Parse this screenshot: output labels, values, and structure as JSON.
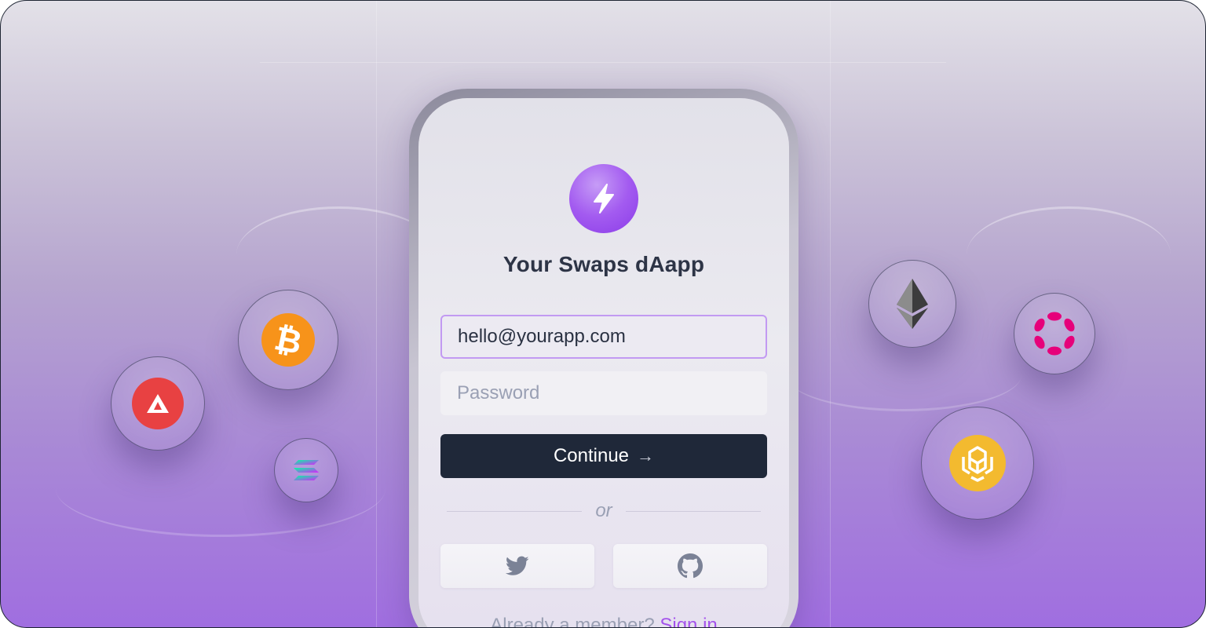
{
  "app": {
    "title": "Your Swaps dAapp"
  },
  "form": {
    "email_value": "hello@yourapp.com",
    "password_placeholder": "Password",
    "continue_label": "Continue",
    "continue_arrow": "→",
    "divider_text": "or",
    "member_text": "Already a member?",
    "signin_label": "Sign in"
  },
  "social_buttons": [
    {
      "icon": "twitter-icon"
    },
    {
      "icon": "github-icon"
    }
  ],
  "coins": [
    {
      "icon": "avalanche-icon",
      "color": "#e84142"
    },
    {
      "icon": "bitcoin-icon",
      "color": "#f7931a"
    },
    {
      "icon": "solana-icon",
      "color": "#9945ff"
    },
    {
      "icon": "ethereum-icon",
      "color": "#343434"
    },
    {
      "icon": "polkadot-icon",
      "color": "#e6007a"
    },
    {
      "icon": "bnb-icon",
      "color": "#f3ba2f"
    }
  ],
  "colors": {
    "accent": "#a452ec",
    "button_bg": "#1f2839"
  }
}
